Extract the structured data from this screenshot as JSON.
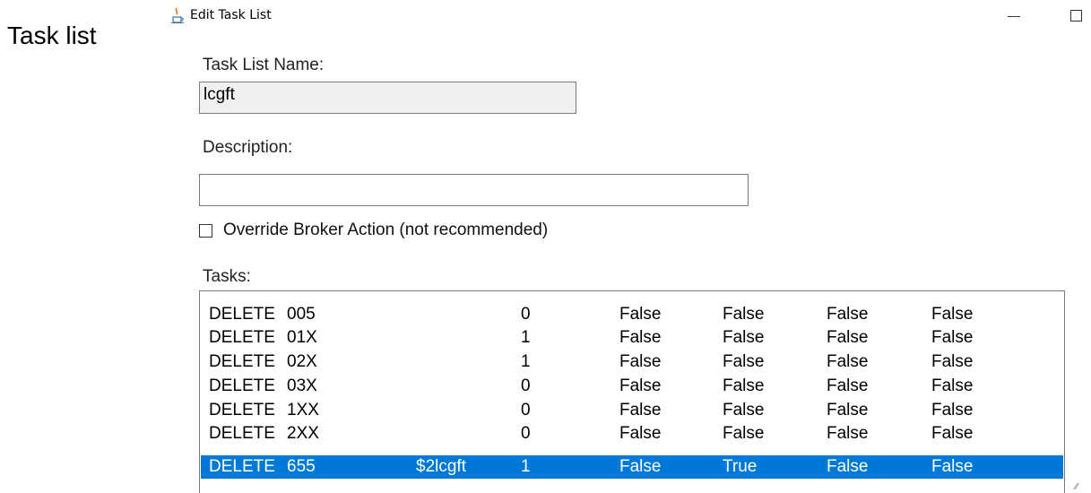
{
  "slide": {
    "title": "Task list"
  },
  "window": {
    "title": "Edit Task List",
    "icon": "java-cup-icon",
    "minimize_icon": "minimize-icon",
    "maximize_icon": "maximize-icon"
  },
  "form": {
    "name_label": "Task List Name:",
    "name_value": "lcgft",
    "description_label": "Description:",
    "description_value": "",
    "override_label": "Override Broker Action (not recommended)",
    "override_checked": false,
    "tasks_label": "Tasks:"
  },
  "tasks": [
    {
      "action": "DELETE",
      "code": "005",
      "user": "",
      "num": "0",
      "f1": "False",
      "f2": "False",
      "f3": "False",
      "f4": "False",
      "selected": false
    },
    {
      "action": "DELETE",
      "code": "01X",
      "user": "",
      "num": "1",
      "f1": "False",
      "f2": "False",
      "f3": "False",
      "f4": "False",
      "selected": false
    },
    {
      "action": "DELETE",
      "code": "02X",
      "user": "",
      "num": "1",
      "f1": "False",
      "f2": "False",
      "f3": "False",
      "f4": "False",
      "selected": false
    },
    {
      "action": "DELETE",
      "code": "03X",
      "user": "",
      "num": "0",
      "f1": "False",
      "f2": "False",
      "f3": "False",
      "f4": "False",
      "selected": false
    },
    {
      "action": "DELETE",
      "code": "1XX",
      "user": "",
      "num": "0",
      "f1": "False",
      "f2": "False",
      "f3": "False",
      "f4": "False",
      "selected": false
    },
    {
      "action": "DELETE",
      "code": "2XX",
      "user": "",
      "num": "0",
      "f1": "False",
      "f2": "False",
      "f3": "False",
      "f4": "False",
      "selected": false
    },
    {
      "action": "DELETE",
      "code": "655",
      "user": "$2lcgft",
      "num": "1",
      "f1": "False",
      "f2": "True",
      "f3": "False",
      "f4": "False",
      "selected": true
    }
  ],
  "colors": {
    "selection": "#0078d7",
    "readonly_field": "#f0f0f0"
  }
}
